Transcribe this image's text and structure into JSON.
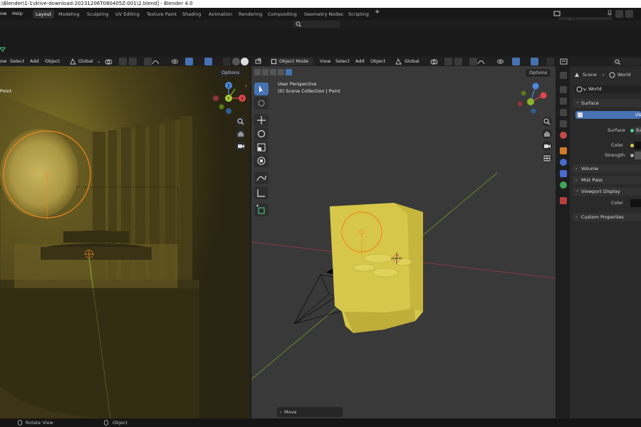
{
  "window": {
    "title": ":\\Blender\\1-1\\drive-download-20231206T080405Z-001\\2.blend] - Blender 4.0"
  },
  "menubar": {
    "menus": [
      "ow",
      "Help"
    ],
    "workspaces": [
      {
        "label": "Layout",
        "active": true
      },
      {
        "label": "Modeling"
      },
      {
        "label": "Sculpting"
      },
      {
        "label": "UV Editing"
      },
      {
        "label": "Texture Paint"
      },
      {
        "label": "Shading"
      },
      {
        "label": "Animation"
      },
      {
        "label": "Rendering"
      },
      {
        "label": "Compositing"
      },
      {
        "label": "Geometry Nodes"
      },
      {
        "label": "Scripting"
      }
    ],
    "add_workspace": "+",
    "scene_name": "Scene"
  },
  "left_viewport": {
    "header": {
      "menus": [
        "ow",
        "Select",
        "Add",
        "Object"
      ],
      "orientation": "Global"
    },
    "options_label": "Options",
    "object_label": "Point"
  },
  "right_viewport": {
    "header": {
      "mode": "Object Mode",
      "menus": [
        "View",
        "Select",
        "Add",
        "Object"
      ],
      "orientation": "Global"
    },
    "options_label": "Options",
    "overlay_title": "User Perspective",
    "overlay_collection": "(0) Scene Collection | Point",
    "gizmo_labels": {
      "z": "Z",
      "y": "Y",
      "x": "X"
    },
    "operator_panel": "Move"
  },
  "properties": {
    "breadcrumb": {
      "scene": "Scene",
      "world": "World"
    },
    "world_name": "World",
    "sections": {
      "surface": "Surface",
      "use_nodes": "Use",
      "surface_label": "Surface",
      "surface_value": "Ba",
      "color_label": "Color",
      "strength_label": "Strength",
      "volume": "Volume",
      "mist_pass": "Mist Pass",
      "viewport_display": "Viewport Display",
      "vd_color_label": "Color",
      "custom_properties": "Custom Properties"
    }
  },
  "statusbar": {
    "left_action": "Rotate View",
    "mid_action": "Object"
  },
  "colors": {
    "accent_blue": "#4772b3",
    "selection_orange": "#f28a1e",
    "mesh_yellow": "#d6c74a",
    "axis_x": "#e0474f",
    "axis_y": "#8ab52a",
    "axis_z": "#4a8be0"
  }
}
